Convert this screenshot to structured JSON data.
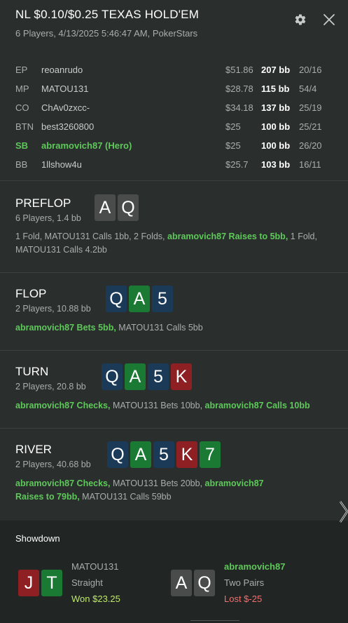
{
  "header": {
    "title": "NL $0.10/$0.25 TEXAS HOLD'EM",
    "subtitle": "6 Players, 4/13/2025 5:46:47 AM, PokerStars"
  },
  "players": [
    {
      "pos": "EP",
      "name": "reoanrudo",
      "stack": "$51.86",
      "bb": "207 bb",
      "record": "20/16"
    },
    {
      "pos": "MP",
      "name": "MATOU131",
      "stack": "$28.78",
      "bb": "115 bb",
      "record": "54/4"
    },
    {
      "pos": "CO",
      "name": "ChAv0zxcc-",
      "stack": "$34.18",
      "bb": "137 bb",
      "record": "25/19"
    },
    {
      "pos": "BTN",
      "name": "best3260800",
      "stack": "$25",
      "bb": "100 bb",
      "record": "25/21"
    },
    {
      "pos": "SB",
      "name": "abramovich87 (Hero)",
      "stack": "$25",
      "bb": "100 bb",
      "record": "26/20"
    },
    {
      "pos": "BB",
      "name": "1llshow4u",
      "stack": "$25.7",
      "bb": "103 bb",
      "record": "16/11"
    }
  ],
  "preflop": {
    "name": "PREFLOP",
    "sub": "6 Players, 1.4 bb",
    "cards": [
      "A",
      "Q"
    ],
    "actions": {
      "a1": "1 Fold, MATOU131 Calls 1bb, 2 Folds, ",
      "a2": "abramovich87 Raises to 5bb,",
      "a3": " 1 Fold, MATOU131 Calls 4.2bb"
    }
  },
  "flop": {
    "name": "FLOP",
    "sub": "2 Players, 10.88 bb",
    "cards": [
      "Q",
      "A",
      "5"
    ],
    "actions": {
      "a1": "abramovich87 Bets 5bb,",
      "a2": " MATOU131 Calls 5bb"
    }
  },
  "turn": {
    "name": "TURN",
    "sub": "2 Players, 20.8 bb",
    "cards": [
      "Q",
      "A",
      "5",
      "K"
    ],
    "actions": {
      "a1": "abramovich87 Checks,",
      "a2": " MATOU131 Bets 10bb, ",
      "a3": "abramovich87 Calls 10bb"
    }
  },
  "river": {
    "name": "RIVER",
    "sub": "2 Players, 40.68 bb",
    "cards": [
      "Q",
      "A",
      "5",
      "K",
      "7"
    ],
    "actions": {
      "a1": "abramovich87 Checks,",
      "a2": " MATOU131 Bets 20bb, ",
      "a3": "abramovich87 Raises to 79bb,",
      "a4": " MATOU131 Calls 59bb"
    }
  },
  "showdown": {
    "title": "Showdown",
    "p1": {
      "name": "MATOU131",
      "hand": "Straight",
      "result": "Won $23.25",
      "cards": [
        "J",
        "T"
      ]
    },
    "p2": {
      "name": "abramovich87",
      "hand": "Two Pairs",
      "result": "Lost $-25",
      "cards": [
        "A",
        "Q"
      ]
    }
  },
  "colors": {
    "hero": "#5ec95a",
    "spade": "#4a4c4c",
    "diamond": "#1a3a58",
    "club": "#1a7a34",
    "heart": "#8e1f23",
    "won": "#bfe86b",
    "lost": "#f07070"
  }
}
